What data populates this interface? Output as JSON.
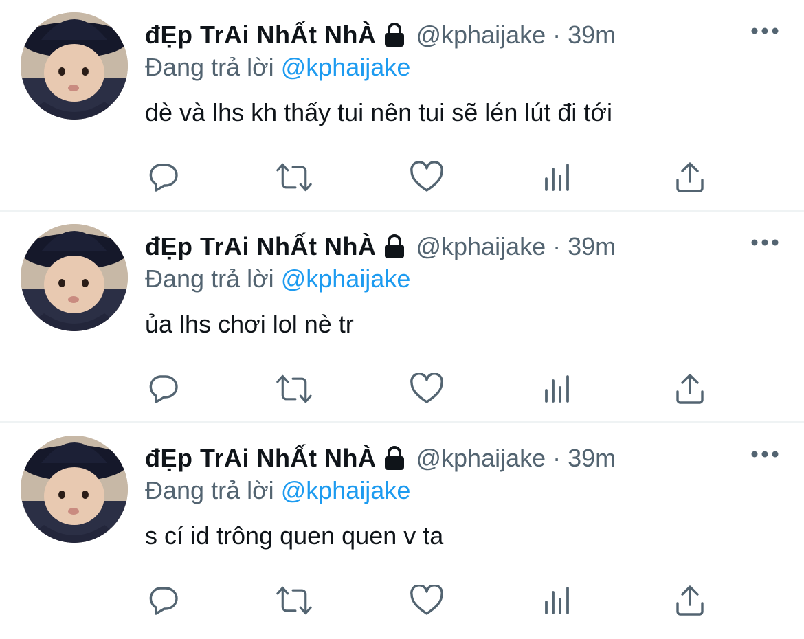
{
  "tweets": [
    {
      "author": {
        "name": "đẸp TrAi NhẤt NhÀ",
        "handle": "@kphaijake",
        "protected_icon": "lock-icon"
      },
      "separator": "·",
      "time": "39m",
      "replying_prefix": "Đang trả lời",
      "replying_to": "@kphaijake",
      "text": "dè và lhs kh thấy tui nên tui sẽ lén lút đi tới"
    },
    {
      "author": {
        "name": "đẸp TrAi NhẤt NhÀ",
        "handle": "@kphaijake",
        "protected_icon": "lock-icon"
      },
      "separator": "·",
      "time": "39m",
      "replying_prefix": "Đang trả lời",
      "replying_to": "@kphaijake",
      "text": "ủa lhs chơi lol nè tr"
    },
    {
      "author": {
        "name": "đẸp TrAi NhẤt NhÀ",
        "handle": "@kphaijake",
        "protected_icon": "lock-icon"
      },
      "separator": "·",
      "time": "39m",
      "replying_prefix": "Đang trả lời",
      "replying_to": "@kphaijake",
      "text": "s cí id trông quen quen v ta"
    }
  ],
  "action_icons": [
    "reply-icon",
    "retweet-icon",
    "like-icon",
    "analytics-icon",
    "share-icon"
  ],
  "colors": {
    "text": "#0f1419",
    "secondary": "#536471",
    "link": "#1d9bf0",
    "divider": "#eff3f4"
  }
}
